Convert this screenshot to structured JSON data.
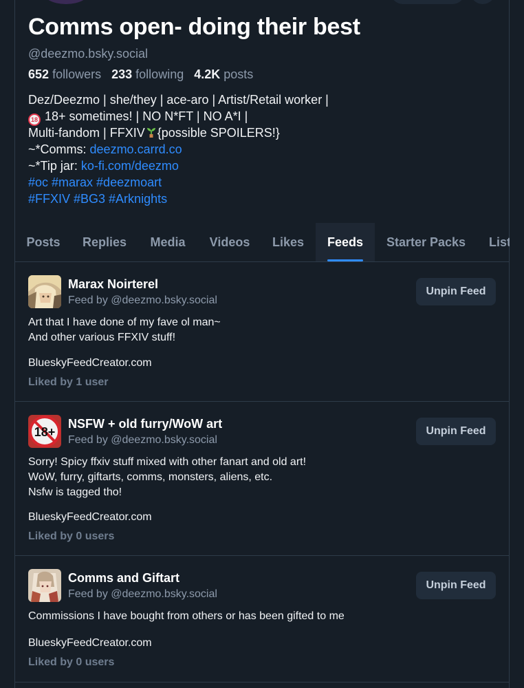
{
  "profile": {
    "display_name": "Comms open- doing their best",
    "handle": "@deezmo.bsky.social",
    "followers_count": "652",
    "followers_label": "followers",
    "following_count": "233",
    "following_label": "following",
    "posts_count": "4.2K",
    "posts_label": "posts",
    "bio": {
      "line1": "Dez/Deezmo | she/they | ace-aro | Artist/Retail worker |",
      "line2_badge": "18",
      "line2": "18+ sometimes! | NO N*FT | NO A*I |",
      "line3a": "Multi-fandom | FFXIV",
      "line3b": "{possible SPOILERS!}",
      "line4_prefix": "~*Comms: ",
      "line4_link": "deezmo.carrd.co",
      "line5_prefix": "~*Tip jar: ",
      "line5_link": "ko-fi.com/deezmo",
      "line6": "#oc #marax #deezmoart",
      "line7": "#FFXIV #BG3 #Arknights"
    }
  },
  "tabs": [
    {
      "label": "Posts"
    },
    {
      "label": "Replies"
    },
    {
      "label": "Media"
    },
    {
      "label": "Videos"
    },
    {
      "label": "Likes"
    },
    {
      "label": "Feeds",
      "active": true
    },
    {
      "label": "Starter Packs"
    },
    {
      "label": "Lists"
    }
  ],
  "feeds": [
    {
      "title": "Marax Noirterel",
      "by": "Feed by @deezmo.bsky.social",
      "button": "Unpin Feed",
      "description": [
        "Art that I have done of my fave ol man~",
        "And other various FFXIV stuff!"
      ],
      "link": "BlueskyFeedCreator.com",
      "liked": "Liked by 1 user"
    },
    {
      "title": "NSFW + old furry/WoW art",
      "by": "Feed by @deezmo.bsky.social",
      "button": "Unpin Feed",
      "avatar_badge": "18+",
      "description": [
        "Sorry! Spicy ffxiv stuff mixed with other fanart and old art!",
        "WoW, furry, giftarts, comms, monsters, aliens, etc.",
        "Nsfw is tagged tho!"
      ],
      "link": "BlueskyFeedCreator.com",
      "liked": "Liked by 0 users"
    },
    {
      "title": "Comms and Giftart",
      "by": "Feed by @deezmo.bsky.social",
      "button": "Unpin Feed",
      "description": [
        "Commissions I have bought from others or has been gifted to me"
      ],
      "link": "BlueskyFeedCreator.com",
      "liked": "Liked by 0 users"
    }
  ],
  "colors": {
    "background": "#161e27",
    "accent": "#2f8cff",
    "muted": "#8d9aab",
    "border": "#2e3b49"
  }
}
